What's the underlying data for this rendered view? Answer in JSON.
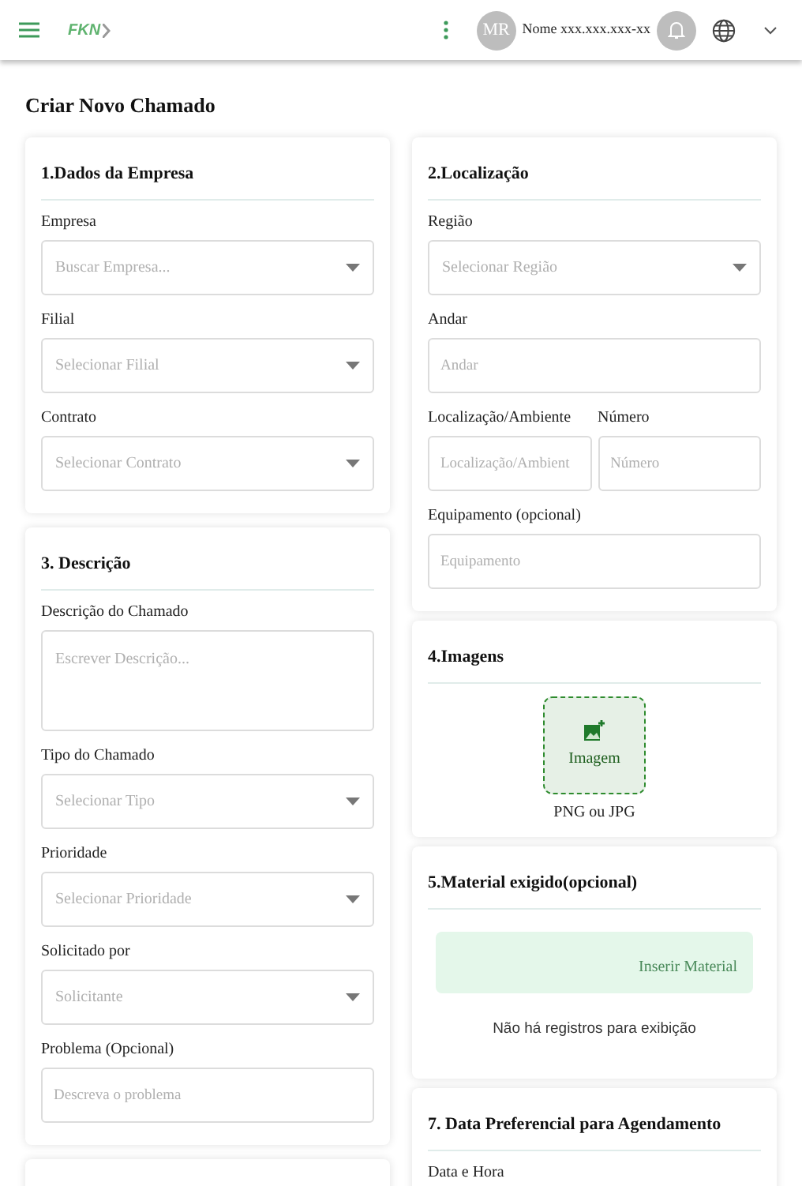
{
  "header": {
    "logo": "FKN",
    "avatar_initials": "MR",
    "user_name": "Nome xxx.xxx.xxx-xx"
  },
  "page_title": "Criar Novo Chamado",
  "left_column": [
    {
      "kind": "form",
      "title": "1.Dados da Empresa",
      "rows": [
        [
          {
            "kind": "select",
            "label": "Empresa",
            "placeholder": "Buscar Empresa..."
          }
        ],
        [
          {
            "kind": "select",
            "label": "Filial",
            "placeholder": "Selecionar Filial"
          }
        ],
        [
          {
            "kind": "select",
            "label": "Contrato",
            "placeholder": "Selecionar Contrato"
          }
        ]
      ]
    },
    {
      "kind": "form",
      "title": "3. Descrição",
      "rows": [
        [
          {
            "kind": "textarea",
            "label": "Descrição do Chamado",
            "placeholder": "Escrever Descrição..."
          }
        ],
        [
          {
            "kind": "select",
            "label": "Tipo do Chamado",
            "placeholder": "Selecionar Tipo"
          }
        ],
        [
          {
            "kind": "select",
            "label": "Prioridade",
            "placeholder": "Selecionar Prioridade"
          }
        ],
        [
          {
            "kind": "select",
            "label": "Solicitado por",
            "placeholder": "Solicitante"
          }
        ],
        [
          {
            "kind": "input",
            "label": "Problema (Opcional)",
            "placeholder": "Descreva o problema"
          }
        ]
      ]
    },
    {
      "kind": "blank"
    }
  ],
  "right_column": [
    {
      "kind": "form",
      "title": "2.Localização",
      "rows": [
        [
          {
            "kind": "select",
            "label": "Região",
            "placeholder": "Selecionar Região"
          }
        ],
        [
          {
            "kind": "input",
            "label": "Andar",
            "placeholder": "Andar"
          }
        ],
        [
          {
            "kind": "input",
            "label": "Localização/Ambiente",
            "placeholder": "Localização/Ambient"
          },
          {
            "kind": "input",
            "label": "Número",
            "placeholder": "Número"
          }
        ],
        [
          {
            "kind": "input",
            "label": "Equipamento (opcional)",
            "placeholder": "Equipamento"
          }
        ]
      ]
    },
    {
      "kind": "upload",
      "title": "4.Imagens",
      "button_label": "Imagem",
      "hint": "PNG ou JPG"
    },
    {
      "kind": "table",
      "title": "5.Material exigido(opcional)",
      "action": "Inserir Material",
      "empty_text": "Não há registros para exibição"
    },
    {
      "kind": "form",
      "title": "7. Data Preferencial para Agendamento",
      "rows": [
        [
          {
            "kind": "label",
            "label": "Data e Hora"
          }
        ]
      ]
    }
  ]
}
